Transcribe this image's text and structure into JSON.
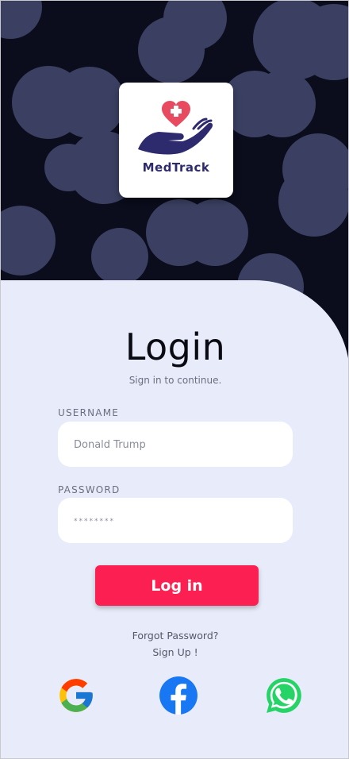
{
  "app": {
    "logo_text": "MedTrack",
    "logo_icon": "hand-heart-icon"
  },
  "login": {
    "title": "Login",
    "subtitle": "Sign in to continue.",
    "username_label": "USERNAME",
    "username_value": "Donald Trump",
    "password_label": "PASSWORD",
    "password_value": "********",
    "button_label": "Log in",
    "forgot_password": "Forgot Password?",
    "sign_up": "Sign Up !"
  },
  "social": [
    {
      "name": "google-icon"
    },
    {
      "name": "facebook-icon"
    },
    {
      "name": "whatsapp-icon"
    }
  ],
  "colors": {
    "background_dark": "#0b0c1c",
    "pattern_circle": "#3b4062",
    "panel": "#e8ecfa",
    "accent": "#fc1f52",
    "logo_text": "#2e2a6e"
  }
}
